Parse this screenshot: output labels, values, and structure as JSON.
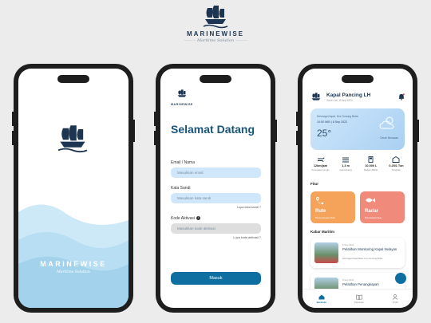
{
  "brand": {
    "name": "MARINEWISE",
    "tagline": "Maritime Solution"
  },
  "splash": {
    "name": "MARINEWISE",
    "tagline": "Maritime Solution"
  },
  "login": {
    "logo_text": "MARINEWISE",
    "title": "Selamat Datang",
    "email_label": "Email / Nama",
    "email_placeholder": "Masukkan email",
    "password_label": "Kata Sandi",
    "password_placeholder": "Masukkan kata sandi",
    "forgot_password": "Lupa kata sandi ?",
    "activation_label": "Kode Aktivasi",
    "activation_placeholder": "Masukkan kode aktivasi",
    "forgot_code": "Lupa kode aktivasi ?",
    "submit": "Masuk"
  },
  "dashboard": {
    "title": "Kapal Pancing LH",
    "subtitle": "Senin Sel, 8 Sep 2022",
    "weather": {
      "location": "Dermaga Kapal, Kec Gunung Bulat",
      "time": "10:50 WIB | 8 Sep 2022",
      "temp": "25°",
      "condition": "Cerah Berawan"
    },
    "stats": [
      {
        "value": "12km/jam",
        "label": "Kecepatan Angin",
        "icon": "wind-icon"
      },
      {
        "value": "1,3 m",
        "label": "Gelombang",
        "icon": "wave-icon"
      },
      {
        "value": "10.000 L",
        "label": "Bahan Bakar",
        "icon": "fuel-icon"
      },
      {
        "value": "0.25/1 Ton",
        "label": "Tangkap",
        "icon": "cargo-icon"
      }
    ],
    "features_title": "Fitur",
    "features": [
      {
        "title": "Rute",
        "subtitle": "Perencanaan Rute",
        "color": "#f5a25b"
      },
      {
        "title": "Radar",
        "subtitle": "Pendeteksi Ikan",
        "color": "#f08a7a"
      }
    ],
    "news_title": "Kabar Maritim",
    "news": [
      {
        "date": "8 Sep 2022",
        "title": "Pelatihan Monitoring Kapal Nelayan",
        "location": "Dermaga Kapal Batu, Kec Gunung Bulat"
      },
      {
        "date": "8 Sep 2022",
        "title": "Pelatihan Penangkapan",
        "location": ""
      }
    ],
    "tabs": [
      {
        "label": "Beranda",
        "icon": "home-icon"
      },
      {
        "label": "Panduan",
        "icon": "book-icon"
      },
      {
        "label": "Profil",
        "icon": "user-icon"
      }
    ]
  }
}
